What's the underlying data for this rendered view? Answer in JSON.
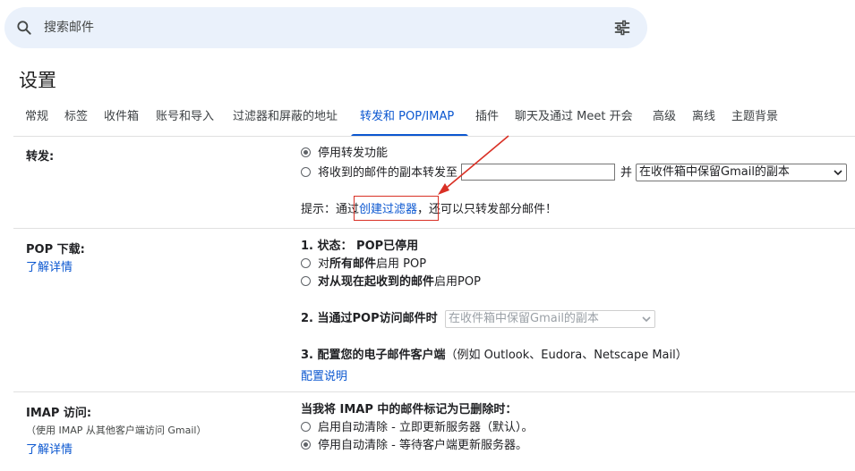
{
  "search": {
    "placeholder": "搜索邮件",
    "icon": "search-icon",
    "filter_icon": "tune-icon"
  },
  "page": {
    "title": "设置"
  },
  "tabs": [
    {
      "label": "常规"
    },
    {
      "label": "标签"
    },
    {
      "label": "收件箱"
    },
    {
      "label": "账号和导入"
    },
    {
      "label": "过滤器和屏蔽的地址"
    },
    {
      "label": "转发和 POP/IMAP",
      "active": true
    },
    {
      "label": "插件"
    },
    {
      "label": "聊天及通过 Meet 开会"
    },
    {
      "label": "高级"
    },
    {
      "label": "离线"
    },
    {
      "label": "主题背景"
    }
  ],
  "colors": {
    "accent": "#0b57d0",
    "search_bg": "#eaf1fb",
    "annotation": "#d93025"
  },
  "forwarding": {
    "label": "转发:",
    "option_disable": "停用转发功能",
    "option_forward": "将收到的邮件的副本转发至",
    "and": "并",
    "keep_option": "在收件箱中保留Gmail的副本",
    "tip_prefix": "提示：通过",
    "tip_link": "创建过滤器",
    "tip_suffix": "，还可以只转发部分邮件！"
  },
  "pop": {
    "label": "POP 下载:",
    "learn_more": "了解详情",
    "status_prefix": "1. 状态：",
    "status_value": "POP已停用",
    "opt_all_1": "对",
    "opt_all_bold": "所有邮件",
    "opt_all_2": "启用 POP",
    "opt_now_bold": "对从现在起收到的邮件",
    "opt_now_2": "启用POP",
    "when_access": "2. 当通过POP访问邮件时",
    "when_access_option": "在收件箱中保留Gmail的副本",
    "configure_bold": "3. 配置您的电子邮件客户端",
    "configure_hint": "（例如 Outlook、Eudora、Netscape Mail）",
    "configure_link": "配置说明"
  },
  "imap": {
    "label": "IMAP 访问:",
    "sublabel": "（使用 IMAP 从其他客户端访问 Gmail）",
    "learn_more": "了解详情",
    "heading": "当我将 IMAP 中的邮件标记为已删除时：",
    "opt_auto_on": "启用自动清除 - 立即更新服务器（默认）。",
    "opt_auto_off": "停用自动清除 - 等待客户端更新服务器。"
  }
}
